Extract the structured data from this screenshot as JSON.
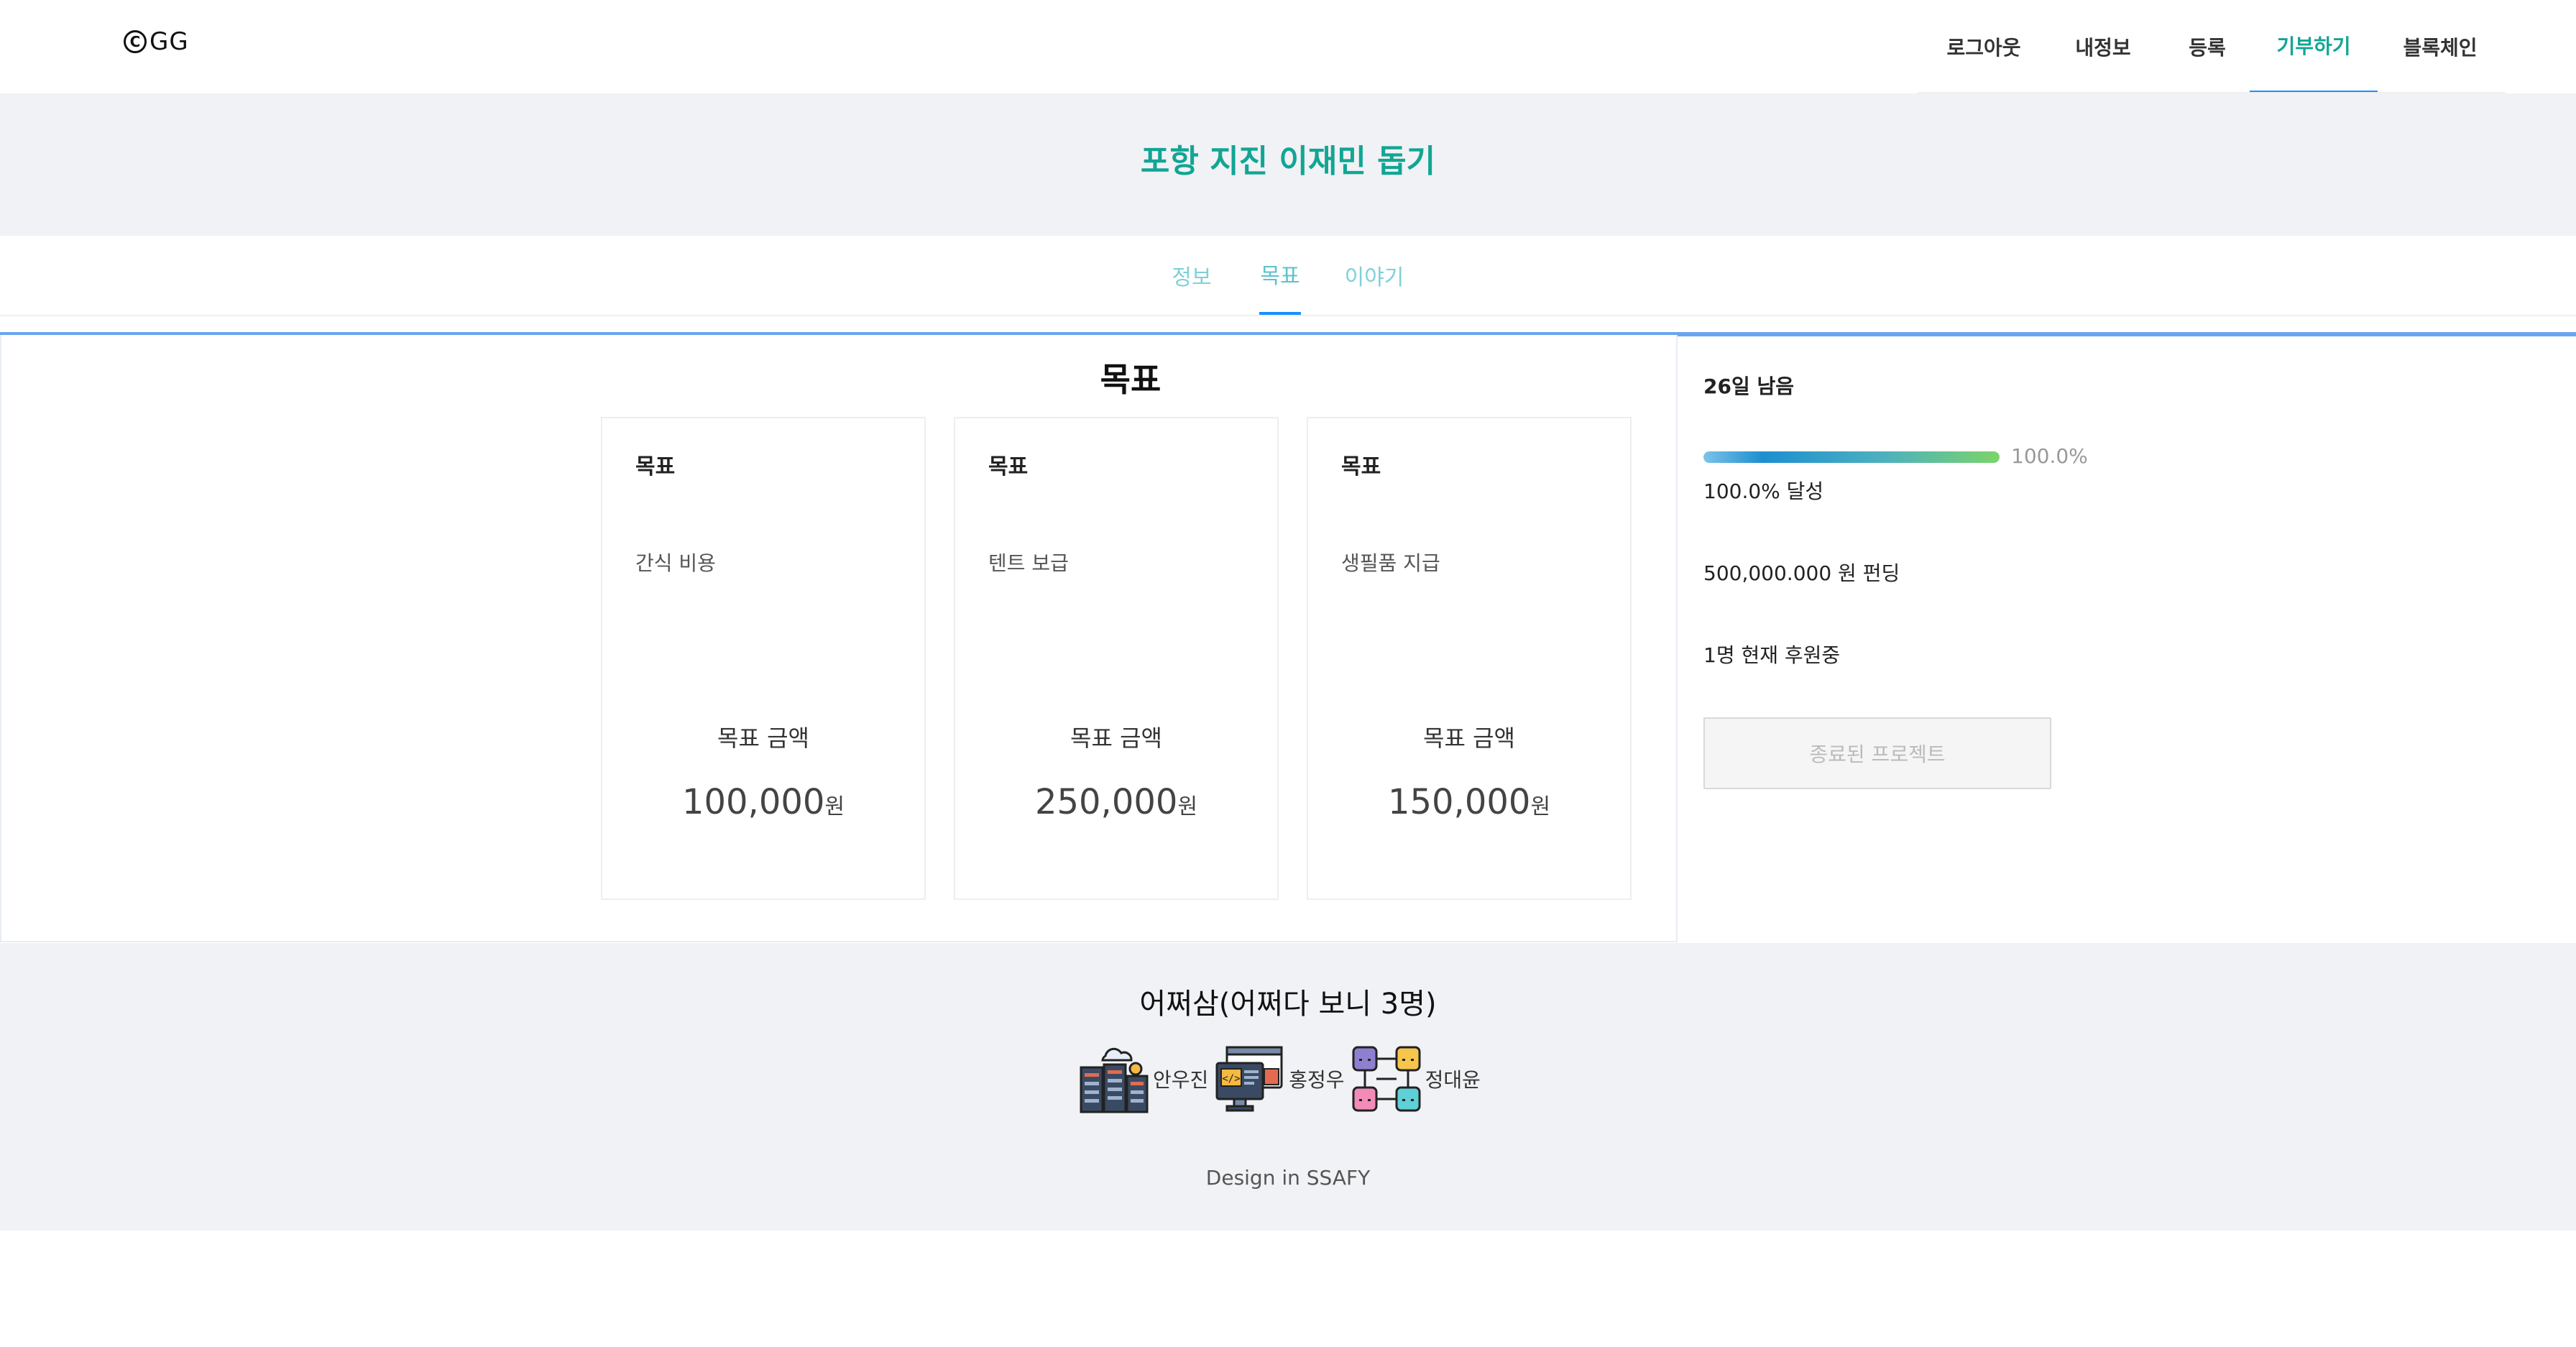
{
  "header": {
    "logo_mark": "C",
    "logo_text": "GG",
    "nav": [
      {
        "label": "로그아웃"
      },
      {
        "label": "내정보"
      },
      {
        "label": "등록"
      },
      {
        "label": "기부하기",
        "active": true
      },
      {
        "label": "블록체인"
      }
    ]
  },
  "banner": {
    "title": "포항 지진 이재민 돕기"
  },
  "tabs": [
    {
      "label": "정보"
    },
    {
      "label": "목표",
      "active": true
    },
    {
      "label": "이야기"
    }
  ],
  "goals": {
    "section_title": "목표",
    "cards": [
      {
        "head": "목표",
        "desc": "간식 비용",
        "amount_label": "목표 금액",
        "amount": "100,000",
        "unit": "원"
      },
      {
        "head": "목표",
        "desc": "텐트 보급",
        "amount_label": "목표 금액",
        "amount": "250,000",
        "unit": "원"
      },
      {
        "head": "목표",
        "desc": "생필품 지급",
        "amount_label": "목표 금액",
        "amount": "150,000",
        "unit": "원"
      }
    ]
  },
  "side": {
    "days_left": "26일 남음",
    "progress": 1.0,
    "progress_text": "100.0%",
    "achieved": "100.0% 달성",
    "funding": "500,000.000 원 펀딩",
    "backers": "1명 현재 후원중",
    "end_button": "종료된 프로젝트"
  },
  "footer": {
    "title": "어쩌삼(어쩌다 보니 3명)",
    "members": [
      {
        "name": "안우진",
        "icon": "server-cloud-icon"
      },
      {
        "name": "홍정우",
        "icon": "code-monitor-icon"
      },
      {
        "name": "정대윤",
        "icon": "network-blocks-icon"
      }
    ],
    "note": "Design in SSAFY"
  },
  "colors": {
    "accent": "#12a594",
    "active_underline": "#1890ff",
    "tab_text": "#7fd0d8",
    "banner_bg": "#f0f2f5"
  }
}
